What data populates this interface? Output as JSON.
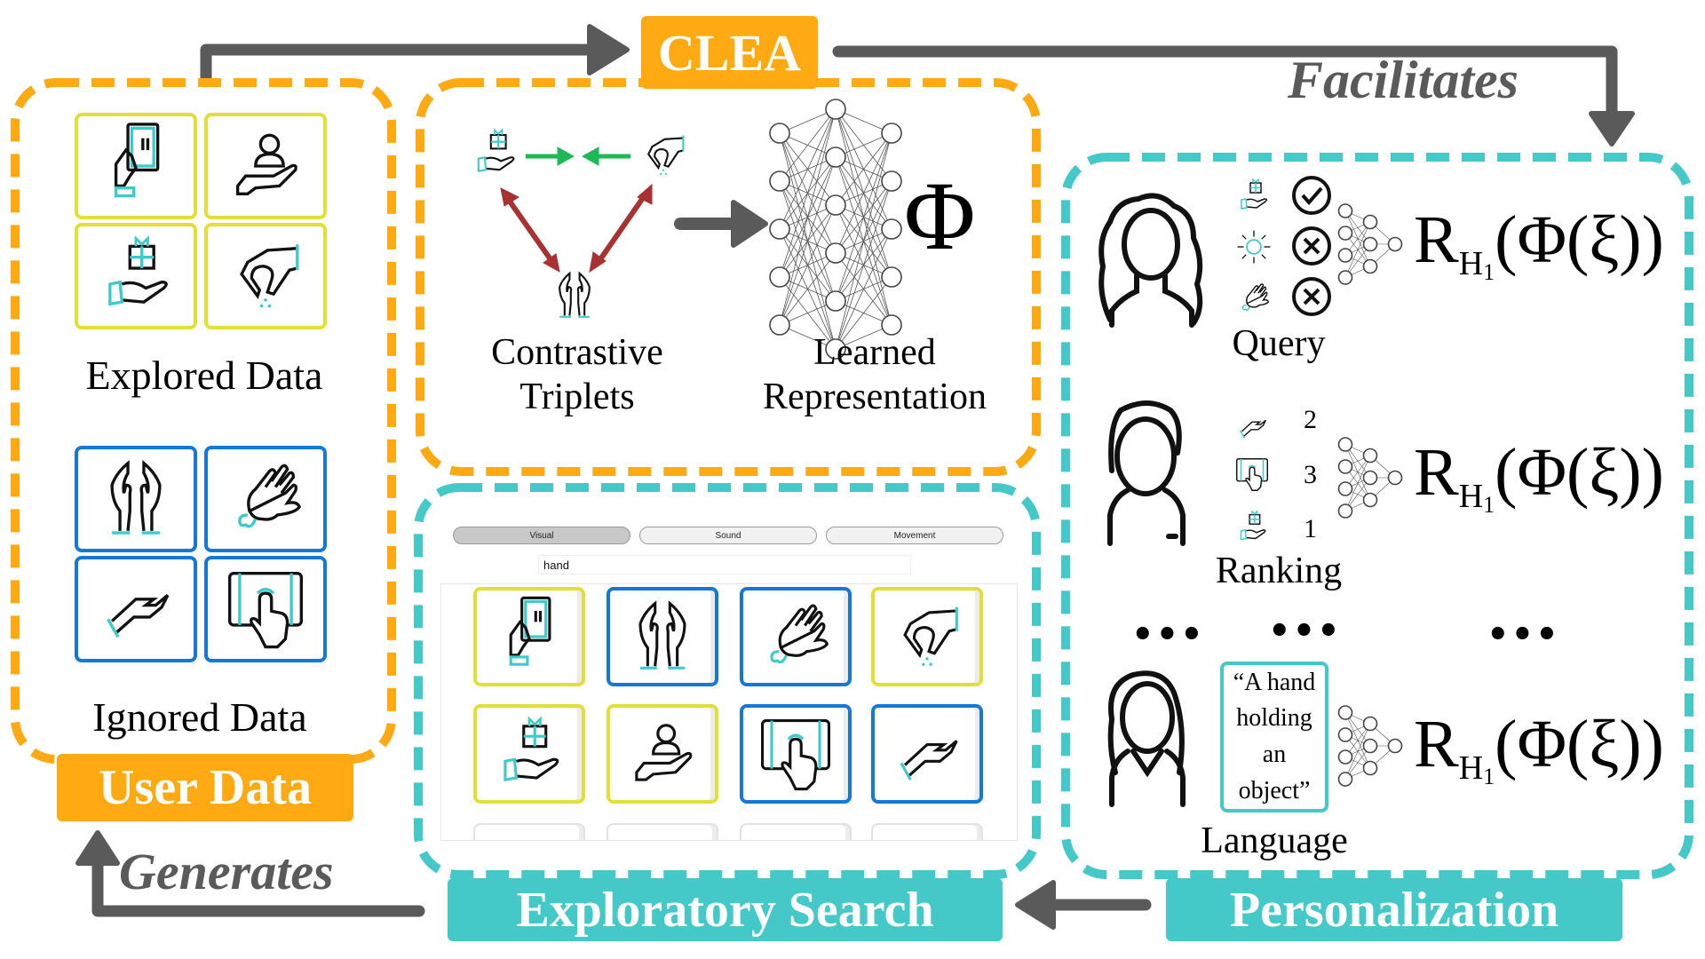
{
  "title": "CLEA",
  "colors": {
    "orange": "#FFAA12",
    "teal": "#44C8C8",
    "arrow_gray": "#5A5A5A",
    "explored_border": "#E2DF36",
    "ignored_border": "#1478D6",
    "positive_arrow": "#1DB954",
    "negative_arrow": "#A83232"
  },
  "flow_labels": {
    "facilitates": "Facilitates",
    "generates": "Generates"
  },
  "user_data": {
    "label": "User Data",
    "explored": {
      "caption": "Explored Data",
      "items": [
        "hand-holding-phone-icon",
        "hand-holding-person-icon",
        "hand-holding-gift-icon",
        "hand-pinching-icon"
      ]
    },
    "ignored": {
      "caption": "Ignored Data",
      "items": [
        "praying-hands-icon",
        "hand-washing-icon",
        "open-palm-hand-icon",
        "finger-tap-tablet-icon"
      ]
    }
  },
  "clea": {
    "triplets_caption_line1": "Contrastive",
    "triplets_caption_line2": "Triplets",
    "representation_caption_line1": "Learned",
    "representation_caption_line2": "Representation",
    "phi": "Φ",
    "network_layers": [
      5,
      6,
      5
    ]
  },
  "exploratory_search": {
    "label": "Exploratory Search",
    "tabs": [
      {
        "label": "Visual",
        "selected": true
      },
      {
        "label": "Sound",
        "selected": false
      },
      {
        "label": "Movement",
        "selected": false
      }
    ],
    "search_value": "hand",
    "results": [
      {
        "icon": "hand-holding-phone-icon",
        "state": "explored"
      },
      {
        "icon": "praying-hands-icon",
        "state": "ignored"
      },
      {
        "icon": "hand-washing-icon",
        "state": "ignored"
      },
      {
        "icon": "hand-pinching-icon",
        "state": "explored"
      },
      {
        "icon": "hand-holding-gift-icon",
        "state": "explored"
      },
      {
        "icon": "hand-holding-person-icon",
        "state": "explored"
      },
      {
        "icon": "finger-tap-tablet-icon",
        "state": "ignored"
      },
      {
        "icon": "open-palm-hand-icon",
        "state": "ignored"
      }
    ]
  },
  "personalization": {
    "label": "Personalization",
    "formula": {
      "R": "R",
      "sub_H": "H",
      "sub_index": "1",
      "rest": "(Φ(ξ))"
    },
    "query": {
      "caption": "Query",
      "rows": [
        {
          "icon": "hand-holding-gift-icon",
          "mark": "check"
        },
        {
          "icon": "sun-icon",
          "mark": "cross"
        },
        {
          "icon": "hand-washing-icon",
          "mark": "cross"
        }
      ]
    },
    "ranking": {
      "caption": "Ranking",
      "rows": [
        {
          "icon": "open-palm-hand-icon",
          "rank": "2"
        },
        {
          "icon": "finger-tap-tablet-icon",
          "rank": "3"
        },
        {
          "icon": "hand-holding-gift-icon",
          "rank": "1"
        }
      ]
    },
    "ellipsis": "•••",
    "language": {
      "caption": "Language",
      "quote": "“A hand holding an object”"
    },
    "small_network_layers": [
      4,
      3,
      1
    ]
  }
}
